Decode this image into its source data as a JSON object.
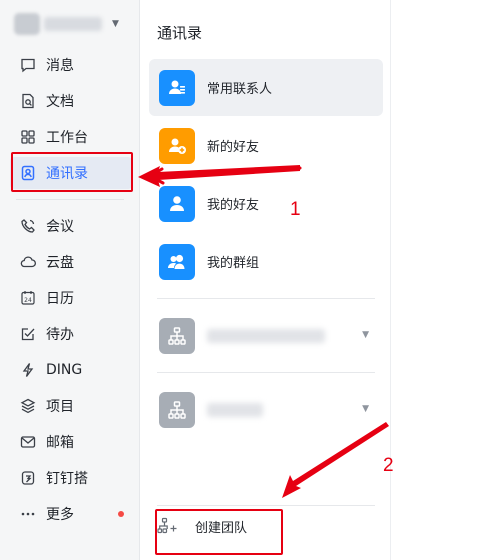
{
  "sidebar": {
    "items": [
      {
        "label": "消息",
        "icon": "message-icon"
      },
      {
        "label": "文档",
        "icon": "document-icon"
      },
      {
        "label": "工作台",
        "icon": "workbench-icon"
      },
      {
        "label": "通讯录",
        "icon": "contacts-icon",
        "active": true
      },
      {
        "label": "会议",
        "icon": "phone-icon"
      },
      {
        "label": "云盘",
        "icon": "cloud-icon"
      },
      {
        "label": "日历",
        "icon": "calendar-icon",
        "badge_text": "24"
      },
      {
        "label": "待办",
        "icon": "todo-icon"
      },
      {
        "label": "DING",
        "icon": "lightning-icon"
      },
      {
        "label": "项目",
        "icon": "project-icon"
      },
      {
        "label": "邮箱",
        "icon": "mail-icon"
      },
      {
        "label": "钉钉搭",
        "icon": "app-builder-icon"
      },
      {
        "label": "更多",
        "icon": "more-icon"
      }
    ]
  },
  "panel": {
    "title": "通讯录",
    "contacts": [
      {
        "label": "常用联系人",
        "icon": "frequent-contacts-icon",
        "color": "#1890ff"
      },
      {
        "label": "新的好友",
        "icon": "new-friend-icon",
        "color": "#ff9c00"
      },
      {
        "label": "我的好友",
        "icon": "my-friends-icon",
        "color": "#1890ff"
      },
      {
        "label": "我的群组",
        "icon": "my-groups-icon",
        "color": "#1890ff"
      }
    ],
    "create_team_label": "创建团队"
  },
  "annotations": {
    "label_1": "1",
    "label_2": "2"
  },
  "colors": {
    "accent": "#3370ff",
    "annotation": "#e60012",
    "badge": "#f54a45"
  }
}
